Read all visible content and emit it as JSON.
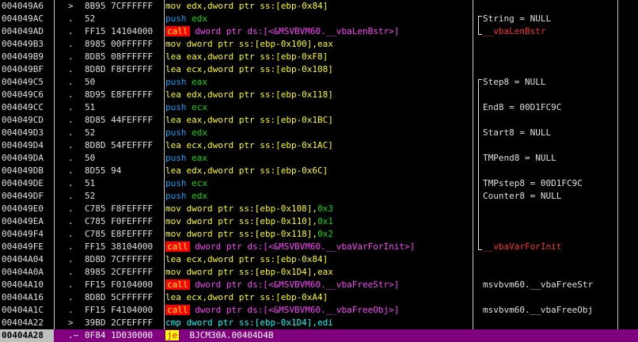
{
  "rows": [
    {
      "addr": "004049A6",
      "mark": ">",
      "hex": "8B95 7CFFFFFF",
      "asm": [
        [
          "kw-yellow",
          "mov "
        ],
        [
          "kw-yellow",
          "edx"
        ],
        [
          "kw-yellow",
          ",dword ptr ss:[ebp-0x84]"
        ]
      ],
      "comment": ""
    },
    {
      "addr": "004049AC",
      "mark": ".",
      "hex": "52",
      "asm": [
        [
          "kw-blue",
          "push "
        ],
        [
          "kw-green",
          "edx"
        ]
      ],
      "comment": "String = NULL"
    },
    {
      "addr": "004049AD",
      "mark": ".",
      "hex": "FF15 14104000",
      "asm": [
        [
          "kw-call",
          "call"
        ],
        [
          "kw-magenta",
          " dword ptr ds:[<&MSVBVM60.__vbaLenBstr>]"
        ]
      ],
      "comment": "__vbaLenBstr",
      "comment_red": true
    },
    {
      "addr": "004049B3",
      "mark": ".",
      "hex": "8985 00FFFFFF",
      "asm": [
        [
          "kw-yellow",
          "mov dword ptr ss:[ebp-0x100],eax"
        ]
      ],
      "comment": ""
    },
    {
      "addr": "004049B9",
      "mark": ".",
      "hex": "8D85 08FFFFFF",
      "asm": [
        [
          "kw-yellow",
          "lea eax,dword ptr ss:[ebp-0xF8]"
        ]
      ],
      "comment": ""
    },
    {
      "addr": "004049BF",
      "mark": ".",
      "hex": "8D8D F8FEFFFF",
      "asm": [
        [
          "kw-yellow",
          "lea ecx,dword ptr ss:[ebp-0x108]"
        ]
      ],
      "comment": ""
    },
    {
      "addr": "004049C5",
      "mark": ".",
      "hex": "50",
      "asm": [
        [
          "kw-blue",
          "push "
        ],
        [
          "kw-green",
          "eax"
        ]
      ],
      "comment": "Step8 = NULL"
    },
    {
      "addr": "004049C6",
      "mark": ".",
      "hex": "8D95 E8FEFFFF",
      "asm": [
        [
          "kw-yellow",
          "lea edx,dword ptr ss:[ebp-0x118]"
        ]
      ],
      "comment": ""
    },
    {
      "addr": "004049CC",
      "mark": ".",
      "hex": "51",
      "asm": [
        [
          "kw-blue",
          "push "
        ],
        [
          "kw-green",
          "ecx"
        ]
      ],
      "comment": "End8 = 00D1FC9C"
    },
    {
      "addr": "004049CD",
      "mark": ".",
      "hex": "8D85 44FEFFFF",
      "asm": [
        [
          "kw-yellow",
          "lea eax,dword ptr ss:[ebp-0x1BC]"
        ]
      ],
      "comment": ""
    },
    {
      "addr": "004049D3",
      "mark": ".",
      "hex": "52",
      "asm": [
        [
          "kw-blue",
          "push "
        ],
        [
          "kw-green",
          "edx"
        ]
      ],
      "comment": "Start8 = NULL"
    },
    {
      "addr": "004049D4",
      "mark": ".",
      "hex": "8D8D 54FEFFFF",
      "asm": [
        [
          "kw-yellow",
          "lea ecx,dword ptr ss:[ebp-0x1AC]"
        ]
      ],
      "comment": ""
    },
    {
      "addr": "004049DA",
      "mark": ".",
      "hex": "50",
      "asm": [
        [
          "kw-blue",
          "push "
        ],
        [
          "kw-green",
          "eax"
        ]
      ],
      "comment": "TMPend8 = NULL"
    },
    {
      "addr": "004049DB",
      "mark": ".",
      "hex": "8D55 94",
      "asm": [
        [
          "kw-yellow",
          "lea edx,dword ptr ss:[ebp-0x6C]"
        ]
      ],
      "comment": ""
    },
    {
      "addr": "004049DE",
      "mark": ".",
      "hex": "51",
      "asm": [
        [
          "kw-blue",
          "push "
        ],
        [
          "kw-green",
          "ecx"
        ]
      ],
      "comment": "TMPstep8 = 00D1FC9C"
    },
    {
      "addr": "004049DF",
      "mark": ".",
      "hex": "52",
      "asm": [
        [
          "kw-blue",
          "push "
        ],
        [
          "kw-green",
          "edx"
        ]
      ],
      "comment": "Counter8 = NULL"
    },
    {
      "addr": "004049E0",
      "mark": ".",
      "hex": "C785 F8FEFFFF",
      "asm": [
        [
          "kw-yellow",
          "mov dword ptr ss:[ebp-0x108],"
        ],
        [
          "kw-green",
          "0x3"
        ]
      ],
      "comment": ""
    },
    {
      "addr": "004049EA",
      "mark": ".",
      "hex": "C785 F0FEFFFF",
      "asm": [
        [
          "kw-yellow",
          "mov dword ptr ss:[ebp-0x110],"
        ],
        [
          "kw-green",
          "0x1"
        ]
      ],
      "comment": ""
    },
    {
      "addr": "004049F4",
      "mark": ".",
      "hex": "C785 E8FEFFFF",
      "asm": [
        [
          "kw-yellow",
          "mov dword ptr ss:[ebp-0x118],"
        ],
        [
          "kw-green",
          "0x2"
        ]
      ],
      "comment": ""
    },
    {
      "addr": "004049FE",
      "mark": ".",
      "hex": "FF15 38104000",
      "asm": [
        [
          "kw-call",
          "call"
        ],
        [
          "kw-magenta",
          " dword ptr ds:[<&MSVBVM60.__vbaVarForInit>]"
        ]
      ],
      "comment": "__vbaVarForInit",
      "comment_red": true
    },
    {
      "addr": "00404A04",
      "mark": ".",
      "hex": "8D8D 7CFFFFFF",
      "asm": [
        [
          "kw-yellow",
          "lea ecx,dword ptr ss:[ebp-0x84]"
        ]
      ],
      "comment": ""
    },
    {
      "addr": "00404A0A",
      "mark": ".",
      "hex": "8985 2CFEFFFF",
      "asm": [
        [
          "kw-yellow",
          "mov dword ptr ss:[ebp-0x1D4],eax"
        ]
      ],
      "comment": ""
    },
    {
      "addr": "00404A10",
      "mark": ".",
      "hex": "FF15 F0104000",
      "asm": [
        [
          "kw-call",
          "call"
        ],
        [
          "kw-magenta",
          " dword ptr ds:[<&MSVBVM60.__vbaFreeStr>]"
        ]
      ],
      "comment": "msvbvm60.__vbaFreeStr"
    },
    {
      "addr": "00404A16",
      "mark": ".",
      "hex": "8D8D 5CFFFFFF",
      "asm": [
        [
          "kw-yellow",
          "lea ecx,dword ptr ss:[ebp-0xA4]"
        ]
      ],
      "comment": ""
    },
    {
      "addr": "00404A1C",
      "mark": ".",
      "hex": "FF15 F4104000",
      "asm": [
        [
          "kw-call",
          "call"
        ],
        [
          "kw-magenta",
          " dword ptr ds:[<&MSVBVM60.__vbaFreeObj>]"
        ]
      ],
      "comment": "msvbvm60.__vbaFreeObj"
    },
    {
      "addr": "00404A22",
      "mark": ">",
      "hex": "39BD 2CFEFFFF",
      "asm": [
        [
          "kw-cyan",
          "cmp dword ptr ss:[ebp-0x1D4],edi"
        ]
      ],
      "comment": ""
    },
    {
      "addr": "00404A28",
      "mark": ".~",
      "hex": "0F84 1D030000",
      "asm": [
        [
          "kw-je",
          "je"
        ],
        [
          "",
          "  BJCM30A.00404D4B"
        ]
      ],
      "comment": "",
      "selected": true
    }
  ]
}
